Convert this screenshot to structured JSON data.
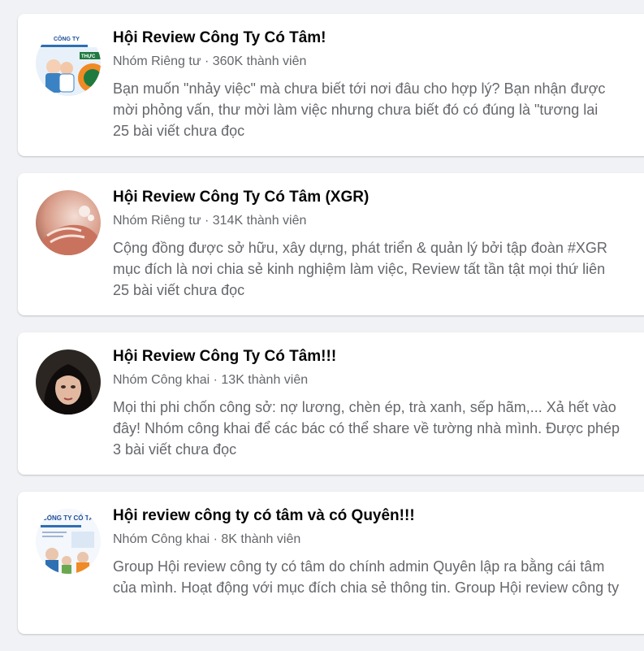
{
  "groups": [
    {
      "title": "Hội Review Công Ty Có Tâm!",
      "privacy": "Nhóm Riêng tư",
      "members": "360K thành viên",
      "desc_line1": "Bạn muốn \"nhảy việc\" mà chưa biết tới nơi đâu cho hợp lý? Bạn nhận được",
      "desc_line2": "mời phỏng vấn, thư mời làm việc nhưng chưa biết đó có đúng là \"tương lai",
      "unread": "25 bài viết chưa đọc",
      "avatar_text": "CÔNG TY",
      "avatar_badge": "THỰC"
    },
    {
      "title": "Hội Review Công Ty Có Tâm (XGR)",
      "privacy": "Nhóm Riêng tư",
      "members": "314K thành viên",
      "desc_line1": "Cộng đồng được sở hữu, xây dựng, phát triển & quản lý bởi tập đoàn #XGR",
      "desc_line2": "mục đích là nơi chia sẻ kinh nghiệm làm việc, Review tất tần tật mọi thứ liên",
      "unread": "25 bài viết chưa đọc"
    },
    {
      "title": "Hội Review Công Ty Có Tâm!!!",
      "privacy": "Nhóm Công khai",
      "members": "13K thành viên",
      "desc_line1": "Mọi thi phi chốn công sở: nợ lương, chèn ép, trà xanh, sếp hãm,... Xả hết vào",
      "desc_line2": "đây! Nhóm công khai để các bác có thể share về tường nhà mình. Được phép",
      "unread": "3 bài viết chưa đọc"
    },
    {
      "title": "Hội review công ty có tâm và có Quyên!!!",
      "privacy": "Nhóm Công khai",
      "members": "8K thành viên",
      "desc_line1": "Group Hội review công ty có tâm do chính admin Quyên lập ra bằng cái tâm",
      "desc_line2": "của mình. Hoạt động với mục đích chia sẻ thông tin. Group Hội review công ty",
      "unread": "",
      "avatar_text": "CÔNG TY CÓ TÂM"
    }
  ],
  "meta_separator": " · ",
  "colors": {
    "page_bg": "#f0f2f5",
    "card_bg": "#ffffff",
    "title": "#050505",
    "secondary": "#65676b"
  }
}
